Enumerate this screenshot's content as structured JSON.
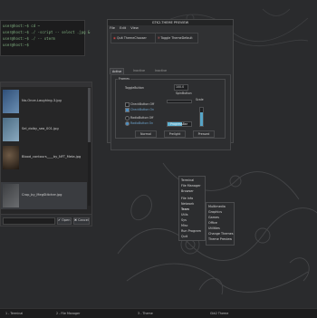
{
  "terminal": {
    "lines": [
      "user@host:~$ cd ~ ",
      "user@host:~$ ./ -script -- select .jpg &",
      "user@host:~$ ./ -- xterm",
      "user@host:~$"
    ]
  },
  "file_browser": {
    "files": [
      {
        "name": "No-Once-Laughing-3.jpg",
        "thumb_color": "#3a5a80"
      },
      {
        "name": "Sel_dolby_sea_001.jpg",
        "thumb_color": "#587a93"
      },
      {
        "name": "Blood_contours____by_NFT_Meta.jpg",
        "thumb_color": "#4a3a2a"
      },
      {
        "name": "Crop_by_MegStitcher.jpg",
        "thumb_color": "#505254"
      }
    ],
    "open_label": "Open",
    "cancel_label": "Cancel"
  },
  "dialog": {
    "title": "GTK2-THEME PREVIEW",
    "menu": [
      "File",
      "Edit",
      "View"
    ],
    "toolbar": {
      "quit_label": "Quit ThemeChooser",
      "toggle_label": "Toggle ThemeDefault"
    },
    "tabs": [
      "Active Tab",
      "Inactive Tab",
      "Inactive Tab"
    ],
    "frame_label": "Frames",
    "toggle_label": "ToggleButton",
    "spin_value": "100.0",
    "spin_label": "SpinButton",
    "check_off": "CheckButton Off",
    "check_on": "CheckButton On",
    "radio_off": "RadioButton Off",
    "radio_on": "RadioButton On",
    "scale_label": "Scale",
    "vscale_level": 0.75,
    "progress_label": "ProgressBar",
    "progress_value": 0.6,
    "buttons": [
      "Normal",
      "Prelight",
      "Pressed"
    ]
  },
  "main_menu": {
    "items": [
      "Terminal",
      "File Manager",
      "Browser",
      "File Info",
      "Network",
      "Team",
      "Utils",
      "Sys",
      "Misc",
      "Run Program",
      "Quit"
    ]
  },
  "sub_menu": {
    "items": [
      "Multimedia",
      "Graphics",
      "Games",
      "Office",
      "Utilities",
      "Change Themes",
      "Theme Preview"
    ]
  },
  "taskbar": {
    "items": [
      "1 - Terminal",
      "2 - File Manager",
      "3 - Theme",
      "Gtk2 Theme"
    ]
  }
}
